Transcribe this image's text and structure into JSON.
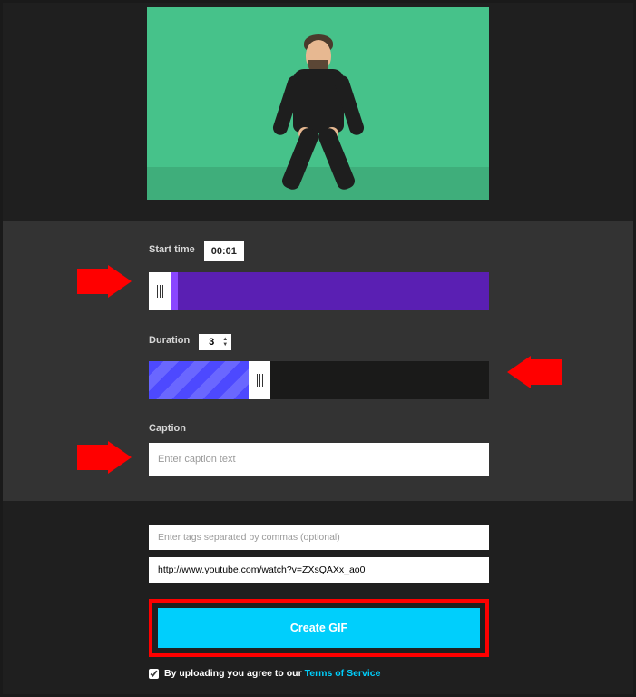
{
  "startTime": {
    "label": "Start time",
    "value": "00:01"
  },
  "duration": {
    "label": "Duration",
    "value": "3"
  },
  "caption": {
    "label": "Caption",
    "placeholder": "Enter caption text"
  },
  "tags": {
    "placeholder": "Enter tags separated by commas (optional)"
  },
  "source": {
    "value": "http://www.youtube.com/watch?v=ZXsQAXx_ao0"
  },
  "createButton": {
    "label": "Create GIF"
  },
  "agree": {
    "prefix": "By uploading you agree to our ",
    "linkText": "Terms of Service"
  }
}
